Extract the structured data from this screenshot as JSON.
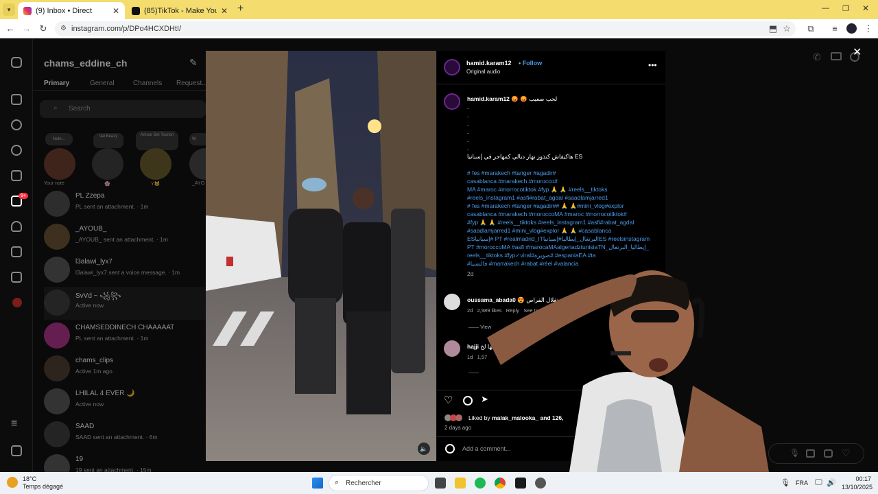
{
  "browser": {
    "tabs": [
      {
        "label": "(9) Inbox • Direct",
        "active": true
      },
      {
        "label": "(85)TikTok - Make Your Day",
        "active": false
      }
    ],
    "url": "instagram.com/p/DPo4HCXDHtI/"
  },
  "sidebar": {
    "username": "chams_eddine_ch",
    "tabs": [
      "Primary",
      "General",
      "Channels",
      "Request..."
    ],
    "search_placeholder": "Search",
    "notes": [
      {
        "bubble": "Note...",
        "label": "Your note"
      },
      {
        "bubble": "Vai Beazy",
        "label": "🌸"
      },
      {
        "bubble": "Amour Bel Tecnon",
        "label": "Y🐱"
      },
      {
        "bubble": "W",
        "label": "_AYO"
      }
    ],
    "badge_count": "9+",
    "conversations": [
      {
        "name": "PL Zzepa",
        "sub": "PL sent an attachment. · 1m"
      },
      {
        "name": "_AYOUB_",
        "sub": "_AYOUB_ sent an attachment. · 1m"
      },
      {
        "name": "l3alawi_lyx7",
        "sub": "l3alawi_lyx7 sent a voice message. · 1m"
      },
      {
        "name": "SvVd ~ ꧁꧂",
        "sub": "Active now"
      },
      {
        "name": "CHAMSEDDINECH CHAAAAAT",
        "sub": "PL sent an attachment. · 1m"
      },
      {
        "name": "chams_clips",
        "sub": "Active 1m ago"
      },
      {
        "name": "LHILAL 4 EVER 🌙",
        "sub": "Active now"
      },
      {
        "name": "SAAD",
        "sub": "SAAD sent an attachment. · 6m"
      },
      {
        "name": "19",
        "sub": "19 sent an attachment. · 15m"
      }
    ]
  },
  "post": {
    "author": "hamid.karam12",
    "follow": "Follow",
    "audio": "Original audio",
    "caption_author": "hamid.karam12",
    "caption_first": "😡 😡 لحب صعيب",
    "caption_dots": [
      ".",
      ".",
      ".",
      ".",
      ".",
      "."
    ],
    "caption_line2": "هاكيفاش كنذوز نهار ديالي كمهاجر في إسبانيا ES",
    "hashtags": [
      "# fes #marakech #tanger #agadir#",
      "casablanca #marakech #morocco#",
      "MA #maroc #morrocotiktok #fyp 🙏 🙏 #reels__tiktoks",
      "#reels_instagram1 #asfi#rabat_agdal #saadlamjarred1",
      "# fes #marakech #tanger #agadir## 🙏 🙏#mini_vlog#explor",
      "casablanca #marakech #moroccoMA #maroc #morrocotiktok#",
      "#fyp 🙏 🙏 #reels__tiktoks #reels_instagram1 #asfi#rabat_agdal",
      "#saadlamjarred1 #mini_vlog#explor 🙏 🙏 #casablanca",
      "ESإسبانيا# PT #realmadrid_ITالبرتغال_إيطاليا#إسبانياES #reelsinstagram",
      "PT #moroccoMA #asfi #marocaMAalgeriadztunisiaTN_إيطاليا_البرتغال_",
      "reels__tiktoks #fyp✓viral#صويرة# #espaniaEA #ta",
      "#فالنسيا #marrakech #rabat #réel #valancia"
    ],
    "caption_time": "2d",
    "comments": [
      {
        "user": "oussama_abada0",
        "text": "😍 استغلال الفراص",
        "meta_time": "2d",
        "meta_likes": "2,989 likes",
        "meta_reply": "Reply",
        "meta_extra": "See tra",
        "view": "View"
      },
      {
        "user": "hajji",
        "text": "داها عطها لخ",
        "meta_time": "1d",
        "meta_likes": "1,57"
      }
    ],
    "liked_by_prefix": "Liked by",
    "liked_by_user": "malak_malooka_",
    "liked_by_suffix": "and 126,",
    "timestamp": "2 days ago",
    "comment_placeholder": "Add a comment..."
  },
  "taskbar": {
    "weather_temp": "18°C",
    "weather_desc": "Temps dégagé",
    "search": "Rechercher",
    "lang": "FRA",
    "time": "00:17",
    "date": "13/10/2025"
  }
}
